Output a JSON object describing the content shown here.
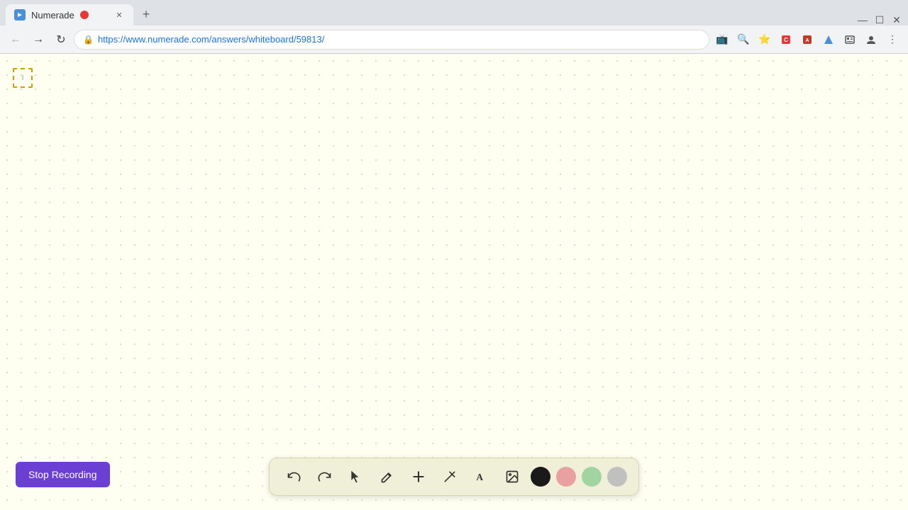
{
  "browser": {
    "tab": {
      "title": "Numerade",
      "url": "https://www.numerade.com/answers/whiteboard/59813/",
      "favicon": "N"
    },
    "window_controls": {
      "minimize": "—",
      "maximize": "☐",
      "close": "✕"
    }
  },
  "toolbar": {
    "stop_recording_label": "Stop Recording",
    "tools": [
      {
        "name": "undo",
        "icon": "↩",
        "label": "Undo"
      },
      {
        "name": "redo",
        "icon": "↪",
        "label": "Redo"
      },
      {
        "name": "select",
        "icon": "↖",
        "label": "Select"
      },
      {
        "name": "pen",
        "icon": "✏",
        "label": "Pen"
      },
      {
        "name": "add",
        "icon": "+",
        "label": "Add"
      },
      {
        "name": "eraser",
        "icon": "◻",
        "label": "Eraser"
      },
      {
        "name": "text",
        "icon": "A",
        "label": "Text"
      },
      {
        "name": "image",
        "icon": "🖼",
        "label": "Image"
      }
    ],
    "colors": [
      {
        "name": "black",
        "hex": "#1a1a1a"
      },
      {
        "name": "pink",
        "hex": "#e8a0a0"
      },
      {
        "name": "green",
        "hex": "#a0d4a0"
      },
      {
        "name": "gray",
        "hex": "#c0c0c0"
      }
    ]
  },
  "whiteboard": {
    "background_color": "#fefff0"
  }
}
